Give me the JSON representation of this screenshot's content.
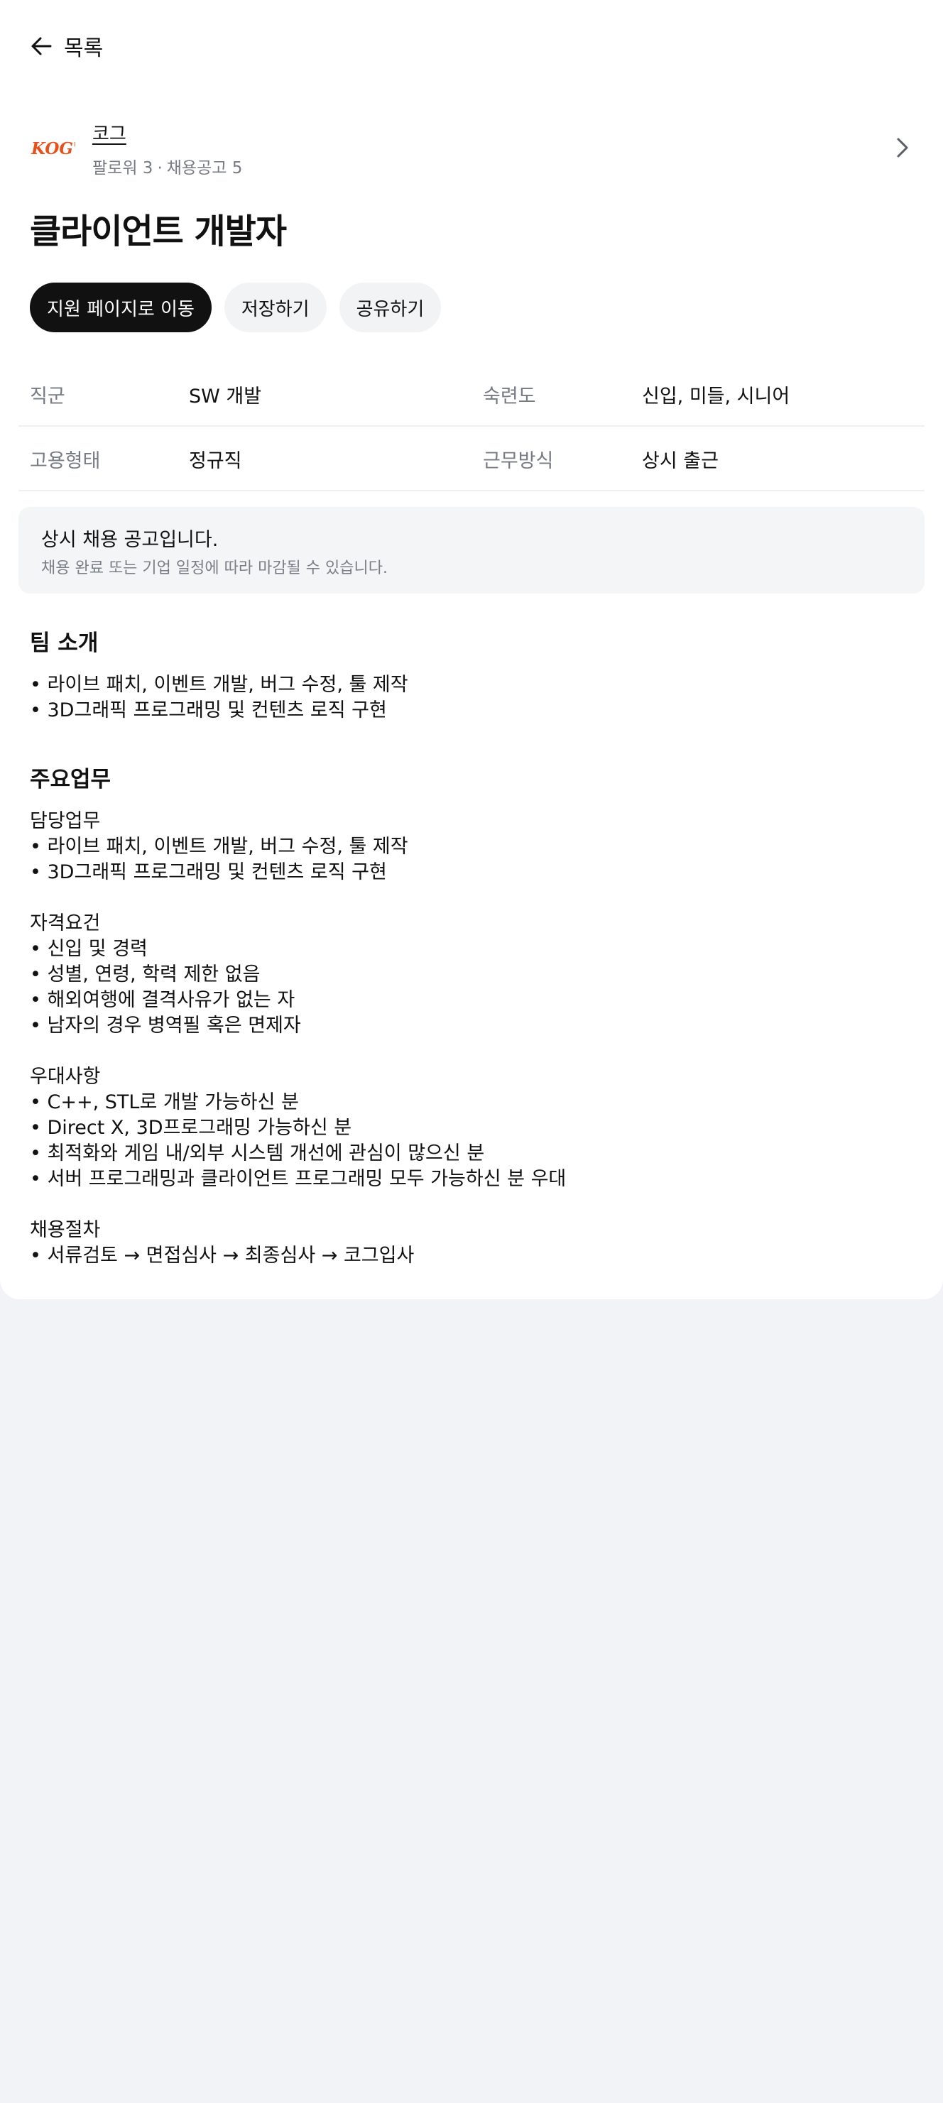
{
  "header": {
    "back_label": "목록"
  },
  "company": {
    "logo_text": "KOG'",
    "name": "코그",
    "followers": "팔로워 3",
    "separator": "·",
    "postings": "채용공고 5"
  },
  "job": {
    "title": "클라이언트 개발자"
  },
  "actions": {
    "apply": "지원 페이지로 이동",
    "save": "저장하기",
    "share": "공유하기"
  },
  "info": {
    "rows": [
      {
        "label1": "직군",
        "value1": "SW 개발",
        "label2": "숙련도",
        "value2": "신입, 미들, 시니어"
      },
      {
        "label1": "고용형태",
        "value1": "정규직",
        "label2": "근무방식",
        "value2": "상시 출근"
      }
    ]
  },
  "notice": {
    "title": "상시 채용 공고입니다.",
    "desc": "채용 완료 또는 기업 일정에 따라 마감될 수 있습니다."
  },
  "team": {
    "title": "팀 소개",
    "lines": [
      "• 라이브 패치, 이벤트 개발, 버그 수정, 툴 제작",
      "• 3D그래픽 프로그래밍 및 컨텐츠 로직 구현"
    ]
  },
  "duties": {
    "title": "주요업무",
    "lines": [
      "담당업무",
      "• 라이브 패치, 이벤트 개발, 버그 수정, 툴 제작",
      "• 3D그래픽 프로그래밍 및 컨텐츠 로직 구현",
      "자격요건",
      "• 신입 및 경력",
      "• 성별, 연령, 학력 제한 없음",
      "• 해외여행에 결격사유가 없는 자",
      "• 남자의 경우 병역필 혹은 면제자",
      "우대사항",
      "• C++, STL로 개발 가능하신 분",
      "• Direct X, 3D프로그래밍 가능하신 분",
      "• 최적화와 게임 내/외부 시스템 개선에 관심이 많으신 분",
      "• 서버 프로그래밍과 클라이언트 프로그래밍 모두 가능하신 분 우대",
      "채용절차",
      "• 서류검토 → 면접심사 → 최종심사 → 코그입사"
    ]
  },
  "colors": {
    "page_bg": "#f2f3f7",
    "card_bg": "#ffffff",
    "primary_button": "#111111",
    "secondary_button": "#f2f3f5",
    "muted_text": "#777b84",
    "logo": "#e8501a"
  }
}
